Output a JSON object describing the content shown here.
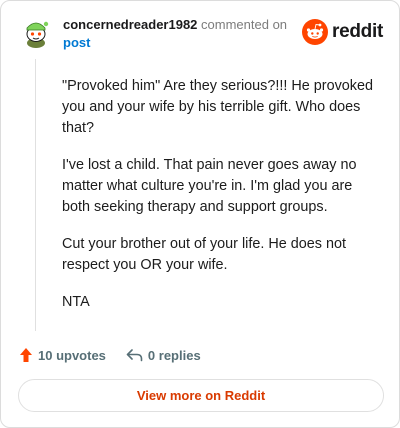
{
  "header": {
    "username": "concernedreader1982",
    "action_text": "commented on",
    "post_link": "post",
    "brand": "reddit",
    "avatar_icon": "snoo-avatar-icon",
    "logo_icon": "reddit-snoo-icon"
  },
  "comment": {
    "paragraphs": [
      "\"Provoked him\" Are they serious?!!! He provoked you and your wife by his terrible gift. Who does that?",
      "I've lost a child. That pain never goes away no matter what culture you're in. I'm glad you are both seeking therapy and support groups.",
      "Cut your brother out of your life. He does not respect you OR your wife.",
      "NTA"
    ]
  },
  "actions": {
    "upvotes_label": "10 upvotes",
    "replies_label": "0 replies"
  },
  "footer": {
    "view_more_label": "View more on Reddit"
  },
  "colors": {
    "accent": "#ff4500",
    "link": "#0079d3",
    "view_more": "#d93a00"
  }
}
